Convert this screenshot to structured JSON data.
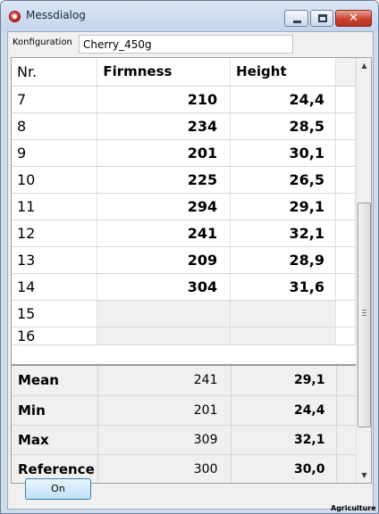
{
  "window": {
    "title": "Messdialog"
  },
  "config": {
    "label": "Konfiguration",
    "value": "Cherry_450g"
  },
  "table": {
    "headers": [
      "Nr.",
      "Firmness",
      "Height"
    ],
    "rows": [
      {
        "nr": "7",
        "firmness": "210",
        "height": "24,4"
      },
      {
        "nr": "8",
        "firmness": "234",
        "height": "28,5"
      },
      {
        "nr": "9",
        "firmness": "201",
        "height": "30,1"
      },
      {
        "nr": "10",
        "firmness": "225",
        "height": "26,5"
      },
      {
        "nr": "11",
        "firmness": "294",
        "height": "29,1"
      },
      {
        "nr": "12",
        "firmness": "241",
        "height": "32,1"
      },
      {
        "nr": "13",
        "firmness": "209",
        "height": "28,9"
      },
      {
        "nr": "14",
        "firmness": "304",
        "height": "31,6"
      },
      {
        "nr": "15",
        "firmness": "",
        "height": ""
      },
      {
        "nr": "16",
        "firmness": "",
        "height": ""
      }
    ]
  },
  "summary": [
    {
      "label": "Mean",
      "firmness": "241",
      "height": "29,1"
    },
    {
      "label": "Min",
      "firmness": "201",
      "height": "24,4"
    },
    {
      "label": "Max",
      "firmness": "309",
      "height": "32,1"
    },
    {
      "label": "Reference",
      "firmness": "300",
      "height": "30,0"
    }
  ],
  "buttons": {
    "ok_label": "On"
  },
  "caption": "Agriculture",
  "icons": {
    "app": "app-logo-icon",
    "minimize": "minimize-icon",
    "maximize": "maximize-icon",
    "close": "close-icon",
    "scroll_up": "scroll-up-arrow-icon",
    "scroll_down": "scroll-down-arrow-icon"
  },
  "colors": {
    "titlebar": "#cfdcec",
    "close_button": "#c8432e",
    "ok_button": "#bfe1f7"
  },
  "scroll": {
    "position_fraction": 0.4
  }
}
